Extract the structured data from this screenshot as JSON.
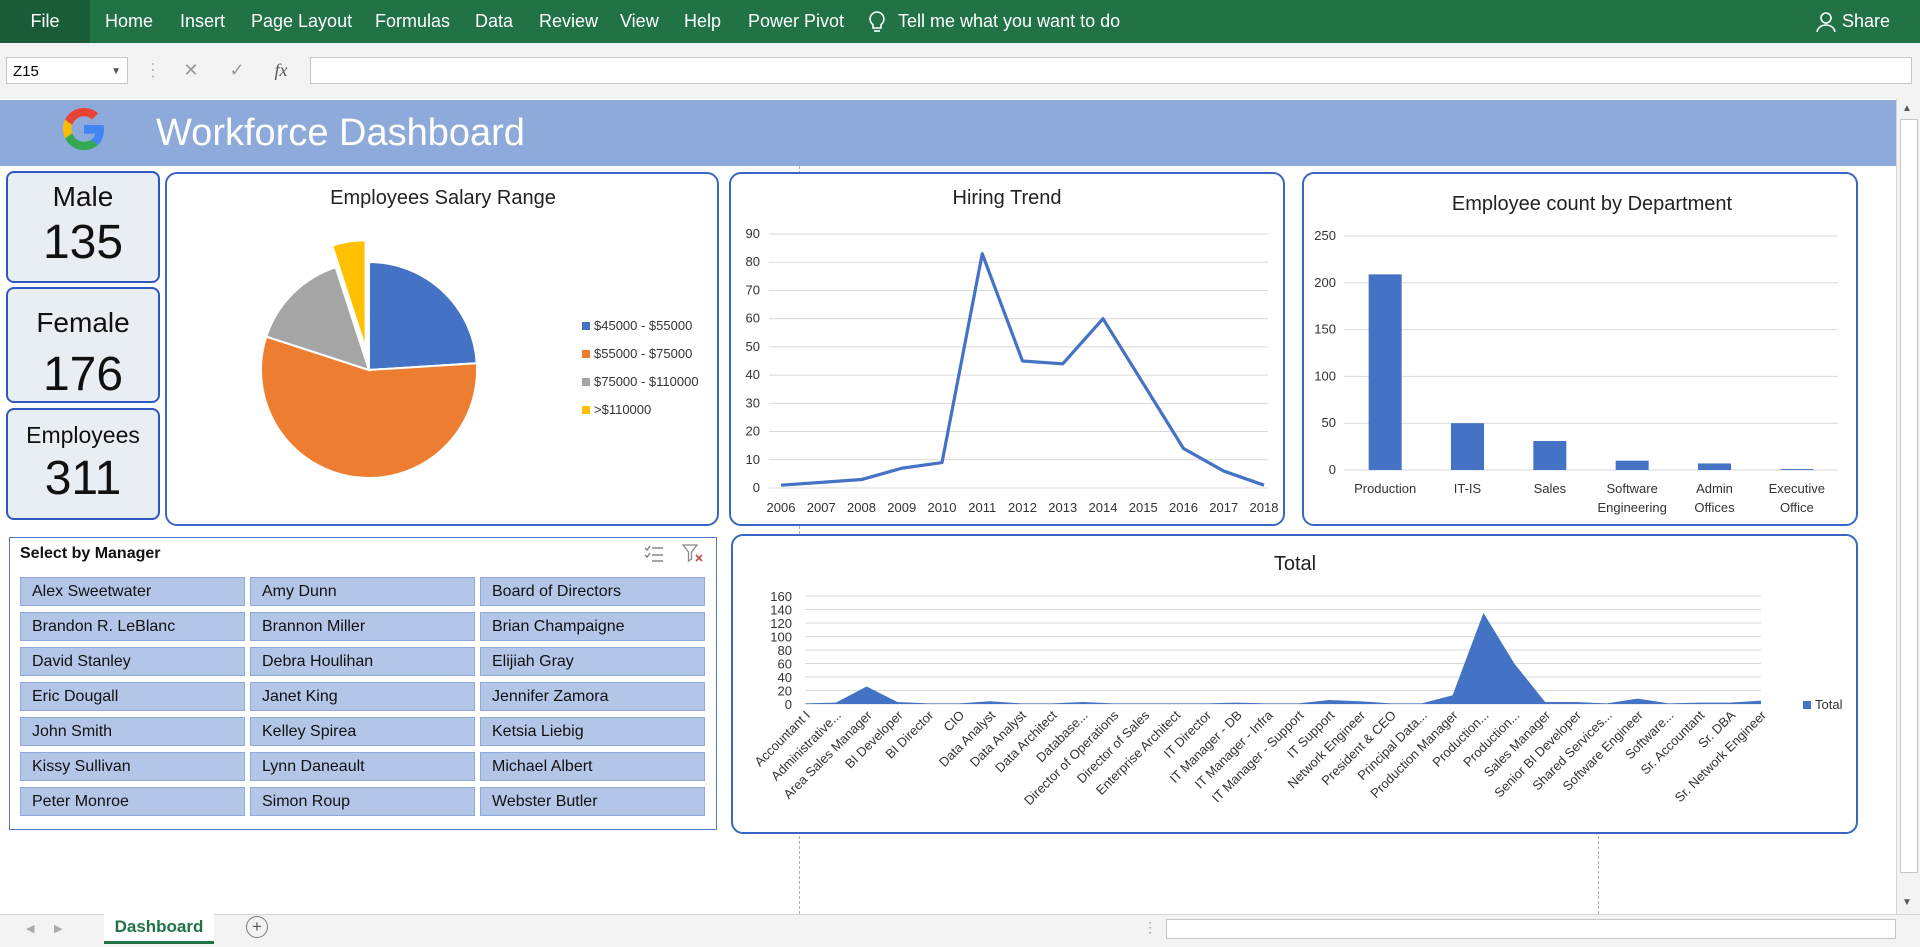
{
  "ribbon": {
    "file": "File",
    "tabs": [
      "Home",
      "Insert",
      "Page Layout",
      "Formulas",
      "Data",
      "Review",
      "View",
      "Help",
      "Power Pivot"
    ],
    "tell_me": "Tell me what you want to do",
    "share": "Share",
    "color": "#217346"
  },
  "formula_bar": {
    "name_box": "Z15",
    "formula": "",
    "fx": "fx"
  },
  "dashboard": {
    "title": "Workforce Dashboard",
    "logo_icon": "google-logo",
    "banner_color": "#8eaadb"
  },
  "kpis": [
    {
      "label": "Male",
      "value": "135"
    },
    {
      "label": "Female",
      "value": "176"
    },
    {
      "label": "Employees",
      "value": "311"
    }
  ],
  "chart_data": [
    {
      "type": "pie",
      "title": "Employees Salary Range",
      "categories": [
        "$45000 - $55000",
        "$55000 - $75000",
        "$75000 - $110000",
        ">$110000"
      ],
      "values": [
        24,
        56,
        15,
        5
      ],
      "colors": [
        "#4472c4",
        "#ed7d31",
        "#a5a5a5",
        "#ffc000"
      ],
      "exploded": ">$110000",
      "legend": "right"
    },
    {
      "type": "line",
      "title": "Hiring Trend",
      "x": [
        "2006",
        "2007",
        "2008",
        "2009",
        "2010",
        "2011",
        "2012",
        "2013",
        "2014",
        "2015",
        "2016",
        "2017",
        "2018"
      ],
      "values": [
        1,
        2,
        3,
        7,
        9,
        83,
        45,
        44,
        60,
        37,
        14,
        6,
        1
      ],
      "ylim": [
        0,
        90
      ],
      "yticks": [
        "0",
        "10",
        "20",
        "30",
        "40",
        "50",
        "60",
        "70",
        "80",
        "90"
      ],
      "grid": true,
      "color": "#4472c4"
    },
    {
      "type": "bar",
      "title": "Employee count by Department",
      "categories": [
        [
          "Production"
        ],
        [
          "IT-IS"
        ],
        [
          "Sales"
        ],
        [
          "Software",
          "Engineering"
        ],
        [
          "Admin",
          "Offices"
        ],
        [
          "Executive",
          "Office"
        ]
      ],
      "values": [
        209,
        50,
        31,
        10,
        7,
        1
      ],
      "ylim": [
        0,
        250
      ],
      "yticks": [
        "0",
        "50",
        "100",
        "150",
        "200",
        "250"
      ],
      "grid": true,
      "color": "#4472c4"
    },
    {
      "type": "area",
      "title": "Total",
      "categories": [
        "Accountant I",
        "Administrative...",
        "Area Sales Manager",
        "BI Developer",
        "BI Director",
        "CIO",
        "Data Analyst",
        "Data Analyst",
        "Data Architect",
        "Database...",
        "Director of Operations",
        "Director of Sales",
        "Enterprise Architect",
        "IT Director",
        "IT Manager - DB",
        "IT Manager - Infra",
        "IT Manager - Support",
        "IT Support",
        "Network Engineer",
        "President & CEO",
        "Principal Data...",
        "Production Manager",
        "Production...",
        "Production...",
        "Sales Manager",
        "Senior BI Developer",
        "Shared Services...",
        "Software Engineer",
        "Software...",
        "Sr. Accountant",
        "Sr. DBA",
        "Sr. Network Engineer"
      ],
      "values": [
        1,
        2,
        26,
        3,
        1,
        1,
        4,
        1,
        1,
        3,
        1,
        1,
        1,
        1,
        2,
        1,
        1,
        6,
        4,
        1,
        1,
        13,
        135,
        60,
        3,
        3,
        1,
        8,
        1,
        2,
        2,
        5
      ],
      "ylim": [
        0,
        160
      ],
      "yticks": [
        "0",
        "20",
        "40",
        "60",
        "80",
        "100",
        "120",
        "140",
        "160"
      ],
      "series": [
        {
          "name": "Total",
          "values": []
        }
      ],
      "legend": "right",
      "grid": true,
      "color": "#4472c4"
    }
  ],
  "slicer": {
    "title": "Select by Manager",
    "items": [
      "Alex Sweetwater",
      "Amy Dunn",
      "Board of Directors",
      "Brandon R. LeBlanc",
      "Brannon Miller",
      "Brian Champaigne",
      "David Stanley",
      "Debra Houlihan",
      "Elijiah Gray",
      "Eric Dougall",
      "Janet King",
      "Jennifer Zamora",
      "John Smith",
      "Kelley Spirea",
      "Ketsia Liebig",
      "Kissy Sullivan",
      "Lynn Daneault",
      "Michael Albert",
      "Peter Monroe",
      "Simon Roup",
      "Webster Butler"
    ]
  },
  "sheet_tabs": [
    "Dashboard"
  ]
}
